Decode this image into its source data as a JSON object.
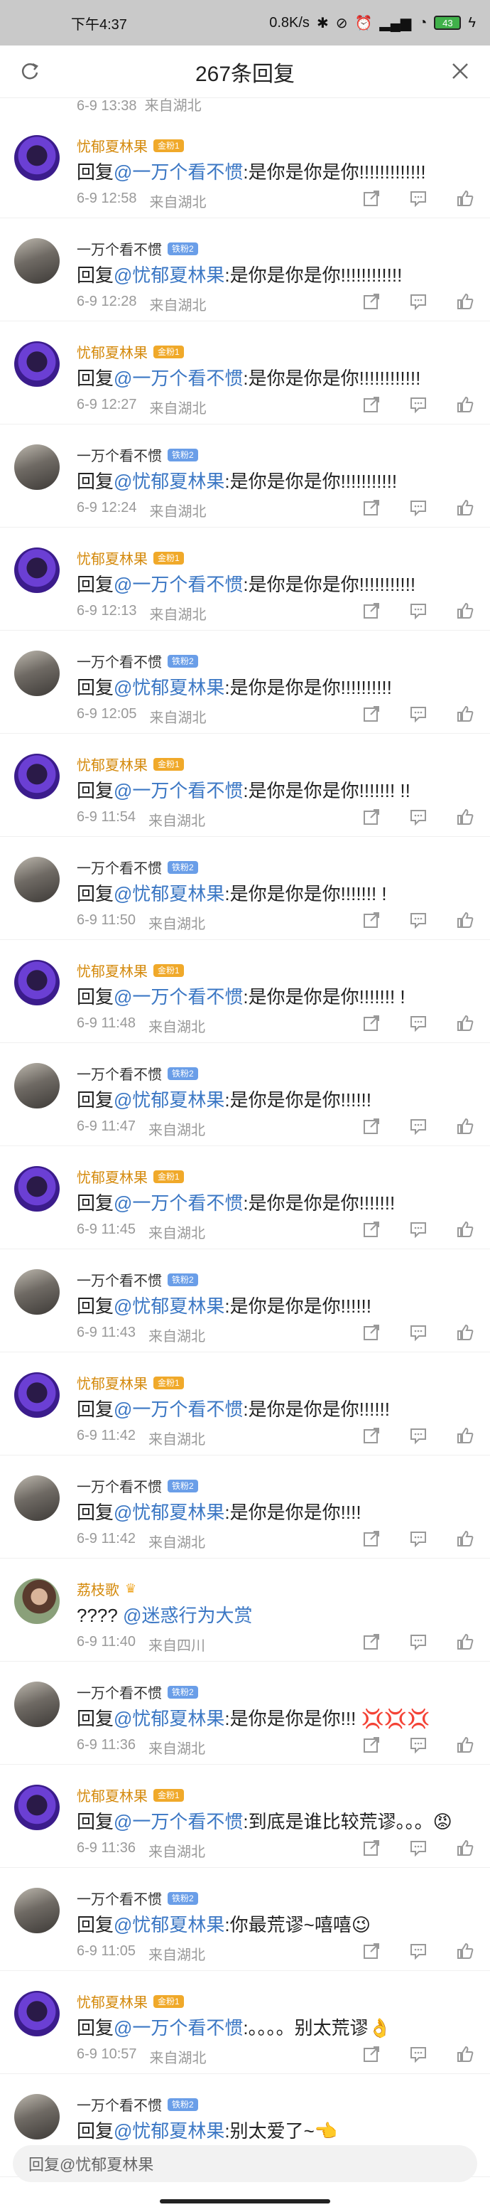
{
  "status_bar": {
    "time": "下午4:37",
    "speed": "0.8K/s",
    "battery": "43"
  },
  "header": {
    "title": "267条回复"
  },
  "partial_top": {
    "time": "6-9 13:38",
    "location": "来自湖北"
  },
  "comments": [
    {
      "avatar": "purple",
      "name": "忧郁夏林果",
      "name_style": "gold",
      "badge": "金粉1",
      "badge_style": "gold",
      "prefix": "回复",
      "mention": "@一万个看不惯",
      "body": ":是你是你是你!!!!!!!!!!!!!",
      "time": "6-9 12:58",
      "location": "来自湖北"
    },
    {
      "avatar": "gray",
      "name": "一万个看不惯",
      "name_style": "dark",
      "badge": "铁粉2",
      "badge_style": "blue",
      "prefix": "回复",
      "mention": "@忧郁夏林果",
      "body": ":是你是你是你!!!!!!!!!!!!",
      "time": "6-9 12:28",
      "location": "来自湖北"
    },
    {
      "avatar": "purple",
      "name": "忧郁夏林果",
      "name_style": "gold",
      "badge": "金粉1",
      "badge_style": "gold",
      "prefix": "回复",
      "mention": "@一万个看不惯",
      "body": ":是你是你是你!!!!!!!!!!!!",
      "time": "6-9 12:27",
      "location": "来自湖北"
    },
    {
      "avatar": "gray",
      "name": "一万个看不惯",
      "name_style": "dark",
      "badge": "铁粉2",
      "badge_style": "blue",
      "prefix": "回复",
      "mention": "@忧郁夏林果",
      "body": ":是你是你是你!!!!!!!!!!!",
      "time": "6-9 12:24",
      "location": "来自湖北"
    },
    {
      "avatar": "purple",
      "name": "忧郁夏林果",
      "name_style": "gold",
      "badge": "金粉1",
      "badge_style": "gold",
      "prefix": "回复",
      "mention": "@一万个看不惯",
      "body": ":是你是你是你!!!!!!!!!!!",
      "time": "6-9 12:13",
      "location": "来自湖北"
    },
    {
      "avatar": "gray",
      "name": "一万个看不惯",
      "name_style": "dark",
      "badge": "铁粉2",
      "badge_style": "blue",
      "prefix": "回复",
      "mention": "@忧郁夏林果",
      "body": ":是你是你是你!!!!!!!!!!",
      "time": "6-9 12:05",
      "location": "来自湖北"
    },
    {
      "avatar": "purple",
      "name": "忧郁夏林果",
      "name_style": "gold",
      "badge": "金粉1",
      "badge_style": "gold",
      "prefix": "回复",
      "mention": "@一万个看不惯",
      "body": ":是你是你是你!!!!!!! !!",
      "time": "6-9 11:54",
      "location": "来自湖北"
    },
    {
      "avatar": "gray",
      "name": "一万个看不惯",
      "name_style": "dark",
      "badge": "铁粉2",
      "badge_style": "blue",
      "prefix": "回复",
      "mention": "@忧郁夏林果",
      "body": ":是你是你是你!!!!!!! !",
      "time": "6-9 11:50",
      "location": "来自湖北"
    },
    {
      "avatar": "purple",
      "name": "忧郁夏林果",
      "name_style": "gold",
      "badge": "金粉1",
      "badge_style": "gold",
      "prefix": "回复",
      "mention": "@一万个看不惯",
      "body": ":是你是你是你!!!!!!! !",
      "time": "6-9 11:48",
      "location": "来自湖北"
    },
    {
      "avatar": "gray",
      "name": "一万个看不惯",
      "name_style": "dark",
      "badge": "铁粉2",
      "badge_style": "blue",
      "prefix": "回复",
      "mention": "@忧郁夏林果",
      "body": ":是你是你是你!!!!!!",
      "time": "6-9 11:47",
      "location": "来自湖北"
    },
    {
      "avatar": "purple",
      "name": "忧郁夏林果",
      "name_style": "gold",
      "badge": "金粉1",
      "badge_style": "gold",
      "prefix": "回复",
      "mention": "@一万个看不惯",
      "body": ":是你是你是你!!!!!!!",
      "time": "6-9 11:45",
      "location": "来自湖北"
    },
    {
      "avatar": "gray",
      "name": "一万个看不惯",
      "name_style": "dark",
      "badge": "铁粉2",
      "badge_style": "blue",
      "prefix": "回复",
      "mention": "@忧郁夏林果",
      "body": ":是你是你是你!!!!!!",
      "time": "6-9 11:43",
      "location": "来自湖北"
    },
    {
      "avatar": "purple",
      "name": "忧郁夏林果",
      "name_style": "gold",
      "badge": "金粉1",
      "badge_style": "gold",
      "prefix": "回复",
      "mention": "@一万个看不惯",
      "body": ":是你是你是你!!!!!!",
      "time": "6-9 11:42",
      "location": "来自湖北"
    },
    {
      "avatar": "gray",
      "name": "一万个看不惯",
      "name_style": "dark",
      "badge": "铁粉2",
      "badge_style": "blue",
      "prefix": "回复",
      "mention": "@忧郁夏林果",
      "body": ":是你是你是你!!!!",
      "time": "6-9 11:42",
      "location": "来自湖北"
    },
    {
      "avatar": "photo",
      "name": "荔枝歌",
      "name_style": "gold",
      "badge": "",
      "badge_style": "crown",
      "prefix": "???? ",
      "mention": "@迷惑行为大赏",
      "body": "",
      "time": "6-9 11:40",
      "location": "来自四川"
    },
    {
      "avatar": "gray",
      "name": "一万个看不惯",
      "name_style": "dark",
      "badge": "铁粉2",
      "badge_style": "blue",
      "prefix": "回复",
      "mention": "@忧郁夏林果",
      "body": ":是你是你是你!!! 💢💢💢",
      "time": "6-9 11:36",
      "location": "来自湖北"
    },
    {
      "avatar": "purple",
      "name": "忧郁夏林果",
      "name_style": "gold",
      "badge": "金粉1",
      "badge_style": "gold",
      "prefix": "回复",
      "mention": "@一万个看不惯",
      "body": ":到底是谁比较荒谬。。。😡",
      "time": "6-9 11:36",
      "location": "来自湖北"
    },
    {
      "avatar": "gray",
      "name": "一万个看不惯",
      "name_style": "dark",
      "badge": "铁粉2",
      "badge_style": "blue",
      "prefix": "回复",
      "mention": "@忧郁夏林果",
      "body": ":你最荒谬~嘻嘻😉",
      "time": "6-9 11:05",
      "location": "来自湖北"
    },
    {
      "avatar": "purple",
      "name": "忧郁夏林果",
      "name_style": "gold",
      "badge": "金粉1",
      "badge_style": "gold",
      "prefix": "回复",
      "mention": "@一万个看不惯",
      "body": ":。。。。别太荒谬👌",
      "time": "6-9 10:57",
      "location": "来自湖北"
    },
    {
      "avatar": "gray",
      "name": "一万个看不惯",
      "name_style": "dark",
      "badge": "铁粉2",
      "badge_style": "blue",
      "prefix": "回复",
      "mention": "@忧郁夏林果",
      "body": ":别太爱了~👈",
      "time": "",
      "location": ""
    }
  ],
  "reply_bar": {
    "placeholder": "回复@忧郁夏林果"
  },
  "icons": {
    "share": "share-icon",
    "comment": "comment-icon",
    "like": "like-icon"
  },
  "colors": {
    "gold_name": "#d4890b",
    "mention": "#3b77c4",
    "meta": "#999999"
  }
}
